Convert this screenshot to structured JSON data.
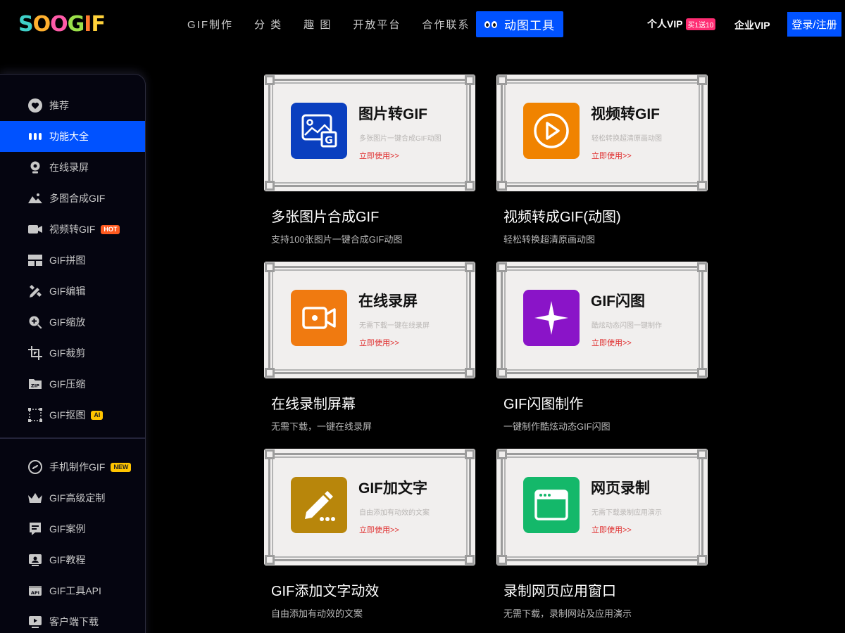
{
  "header": {
    "logo_text": "SOOGIF",
    "nav": [
      "GIF制作",
      "分 类",
      "趣 图",
      "开放平台",
      "合作联系"
    ],
    "tool_button": "动图工具",
    "vip_personal": "个人VIP",
    "vip_promo": "买1送10",
    "vip_enterprise": "企业VIP",
    "login": "登录/注册"
  },
  "sidebar": {
    "group1": [
      {
        "label": "推荐",
        "icon": "heart-icon"
      },
      {
        "label": "功能大全",
        "icon": "dots-icon",
        "active": true
      },
      {
        "label": "在线录屏",
        "icon": "webcam-icon"
      },
      {
        "label": "多图合成GIF",
        "icon": "image-icon"
      },
      {
        "label": "视频转GIF",
        "icon": "video-camera-icon",
        "badge": "HOT"
      },
      {
        "label": "GIF拼图",
        "icon": "grid-icon"
      },
      {
        "label": "GIF编辑",
        "icon": "edit-icon"
      },
      {
        "label": "GIF缩放",
        "icon": "zoom-icon"
      },
      {
        "label": "GIF裁剪",
        "icon": "crop-icon"
      },
      {
        "label": "GIF压缩",
        "icon": "zip-icon"
      },
      {
        "label": "GIF抠图",
        "icon": "cutout-icon",
        "badge": "AI"
      }
    ],
    "group2": [
      {
        "label": "手机制作GIF",
        "icon": "mobile-icon",
        "badge": "NEW"
      },
      {
        "label": "GIF高级定制",
        "icon": "crown-icon"
      },
      {
        "label": "GIF案例",
        "icon": "case-icon"
      },
      {
        "label": "GIF教程",
        "icon": "tutorial-icon"
      },
      {
        "label": "GIF工具API",
        "icon": "api-icon"
      },
      {
        "label": "客户端下载",
        "icon": "monitor-icon"
      }
    ]
  },
  "cards": [
    {
      "frame_title": "图片转GIF",
      "frame_desc": "多张图片一键合成GIF动图",
      "cta": "立即使用>>",
      "title": "多张图片合成GIF",
      "subtitle": "支持100张图片一键合成GIF动图",
      "icon": "image-g-icon",
      "color": "#0a3fbf"
    },
    {
      "frame_title": "视频转GIF",
      "frame_desc": "轻松转换超清原画动图",
      "cta": "立即使用>>",
      "title": "视频转成GIF(动图)",
      "subtitle": "轻松转换超清原画动图",
      "icon": "play-icon",
      "color": "#f08300"
    },
    {
      "frame_title": "在线录屏",
      "frame_desc": "无需下载一键在线录屏",
      "cta": "立即使用>>",
      "title": "在线录制屏幕",
      "subtitle": "无需下载，一键在线录屏",
      "icon": "record-icon",
      "color": "#f07a10"
    },
    {
      "frame_title": "GIF闪图",
      "frame_desc": "酷炫动态闪图一键制作",
      "cta": "立即使用>>",
      "title": "GIF闪图制作",
      "subtitle": "一键制作酷炫动态GIF闪图",
      "icon": "sparkle-icon",
      "color": "#8a14c8"
    },
    {
      "frame_title": "GIF加文字",
      "frame_desc": "自由添加有动效的文案",
      "cta": "立即使用>>",
      "title": "GIF添加文字动效",
      "subtitle": "自由添加有动效的文案",
      "icon": "pencil-icon",
      "color": "#b8860b"
    },
    {
      "frame_title": "网页录制",
      "frame_desc": "无需下载录制应用演示",
      "cta": "立即使用>>",
      "title": "录制网页应用窗口",
      "subtitle": "无需下载，录制网站及应用演示",
      "icon": "browser-icon",
      "color": "#14b86a"
    }
  ]
}
